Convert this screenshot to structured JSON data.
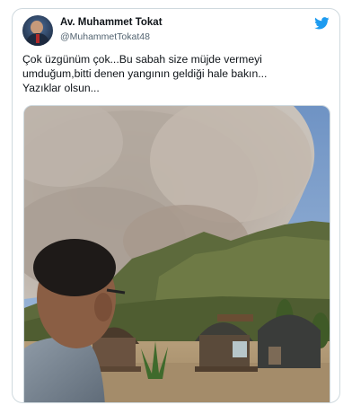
{
  "tweet": {
    "author_name": "Av. Muhammet Tokat",
    "author_handle": "@MuhammetTokat48",
    "text_lines": [
      "Çok üzgünüm çok...Bu sabah size müjde vermeyi",
      "umduğum,bitti denen yangının geldiği hale bakın...",
      "Yazıklar olsun..."
    ],
    "icons": {
      "brand": "twitter-bird-icon",
      "avatar": "profile-avatar"
    },
    "colors": {
      "brand": "#1d9bf0",
      "text": "#0f1419",
      "secondary": "#536471",
      "border": "#cfd9de"
    }
  }
}
